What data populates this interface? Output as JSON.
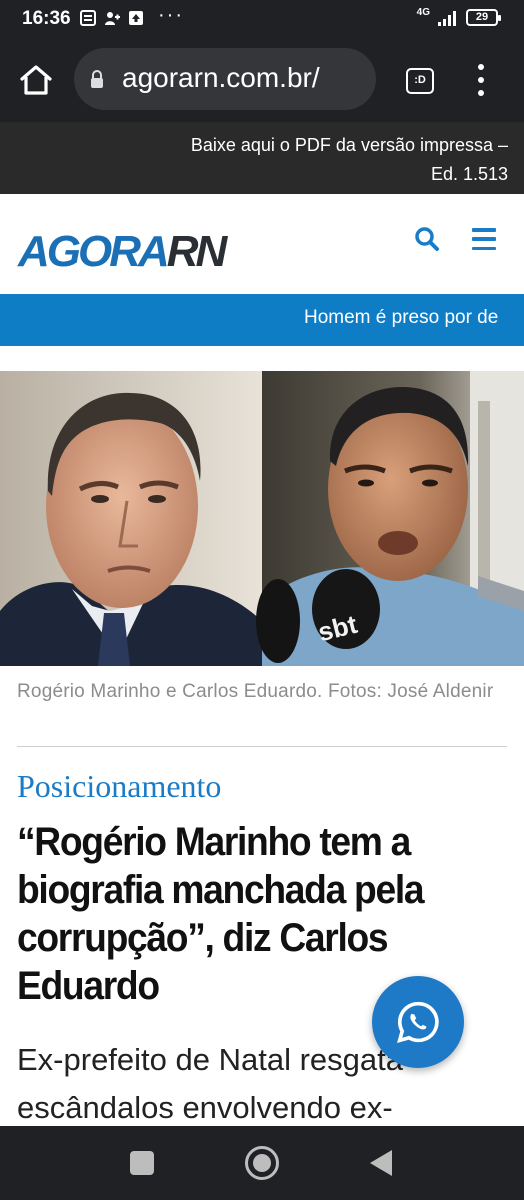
{
  "status_bar": {
    "time": "16:36",
    "network": "4G",
    "battery": "29"
  },
  "browser": {
    "url": "agorarn.com.br/",
    "tab_label": ":D"
  },
  "site_topbar": {
    "social_icons": [
      "facebook-icon",
      "twitter-icon",
      "instagram-icon"
    ],
    "pdf_link": "Baixe aqui o PDF da versão impressa – Ed. 1.513"
  },
  "header": {
    "logo_agora": "AGORA",
    "logo_rn": "RN"
  },
  "ticker": {
    "text": "Homem é preso por de"
  },
  "article": {
    "photo_caption": "Rogério Marinho e Carlos Eduardo. Fotos: José Aldenir",
    "category": "Posicionamento",
    "headline": "“Rogério Marinho tem a biografia manchada pela corrupção”, diz Carlos Eduardo",
    "subtitle_line1": "Ex-prefeito de Natal resgata",
    "subtitle_line2": "escândalos envolvendo ex-",
    "microphone_logo": "sbt"
  },
  "colors": {
    "brand_blue": "#1a7cc7",
    "ticker_blue": "#0f7dc6",
    "dark_bar": "#202124"
  }
}
